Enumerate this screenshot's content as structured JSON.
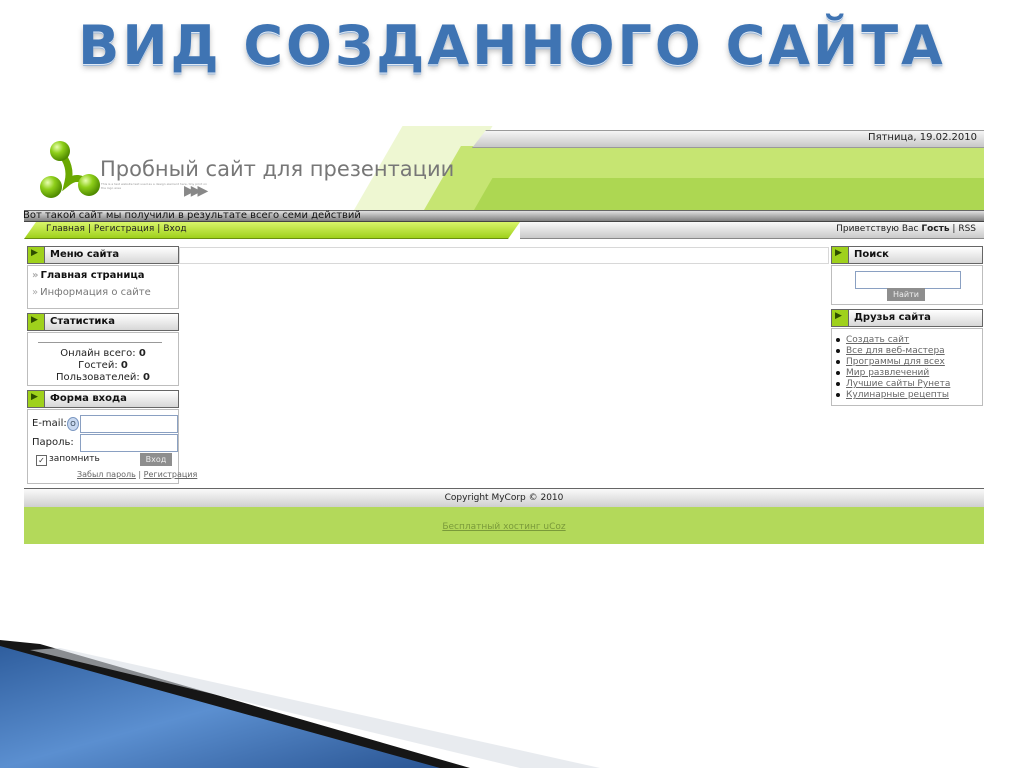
{
  "slide": {
    "title": "ВИД СОЗДАННОГО САЙТА"
  },
  "header": {
    "date": "Пятница, 19.02.2010",
    "site_name": "Пробный сайт для презентации",
    "tiny_text": "This is a test website text used as a design element here, tiny print on the logo area"
  },
  "slogan": "Вот такой сайт мы получили в результате всего семи действий",
  "nav": {
    "links": [
      "Главная",
      "Регистрация",
      "Вход"
    ],
    "separator": "|"
  },
  "greeting": {
    "prefix": "Приветствую Вас",
    "user": "Гость",
    "separator": "|",
    "rss": "RSS"
  },
  "menu": {
    "title": "Меню сайта",
    "items": [
      {
        "label": "Главная страница"
      },
      {
        "label": "Информация о сайте"
      }
    ]
  },
  "stats": {
    "title": "Статистика",
    "online_label": "Онлайн всего:",
    "online_value": "0",
    "guests_label": "Гостей:",
    "guests_value": "0",
    "users_label": "Пользователей:",
    "users_value": "0"
  },
  "login": {
    "title": "Форма входа",
    "email_label": "E-mail:",
    "password_label": "Пароль:",
    "remember_label": "запомнить",
    "submit_label": "Вход",
    "forgot_label": "Забыл пароль",
    "separator": "|",
    "register_label": "Регистрация"
  },
  "search": {
    "title": "Поиск",
    "button_label": "Найти"
  },
  "friends": {
    "title": "Друзья сайта",
    "items": [
      "Создать сайт",
      "Все для веб-мастера",
      "Программы для всех",
      "Мир развлечений",
      "Лучшие сайты Рунета",
      "Кулинарные рецепты"
    ]
  },
  "footer": {
    "copyright": "Copyright MyCorp © 2010",
    "hosting": "Бесплатный хостинг uCoz"
  },
  "colors": {
    "title_blue": "#3f74b3",
    "green": "#9fd11c",
    "footer_green": "#b3d95a"
  }
}
